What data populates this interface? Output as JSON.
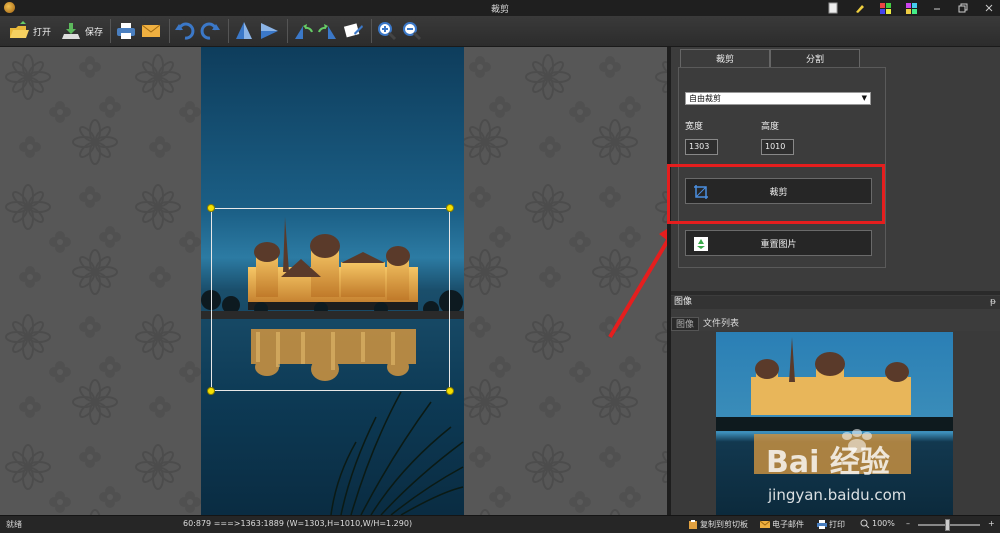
{
  "window": {
    "title": "裁剪"
  },
  "toolbar": {
    "open_label": "打开",
    "save_label": "保存"
  },
  "panel": {
    "tabs": [
      "裁剪",
      "分割"
    ],
    "crop_mode": "自由裁剪",
    "width_label": "宽度",
    "height_label": "高度",
    "width_value": "1303",
    "height_value": "1010",
    "crop_button": "裁剪",
    "reset_button": "重置图片"
  },
  "image_section": {
    "header": "图像",
    "pin": "ᵽ",
    "tabs": [
      "图像",
      "文件列表"
    ],
    "watermark_logo": "Bai 经验",
    "watermark_url": "jingyan.baidu.com"
  },
  "status": {
    "ready": "就绪",
    "coords": "60:879 ===>1363:1889 (W=1303,H=1010,W/H=1.290)",
    "copy_clipboard": "复制到剪切板",
    "email": "电子邮件",
    "print": "打印",
    "zoom": "100%",
    "zoom_minus": "–",
    "zoom_plus": "+"
  },
  "colors": {
    "highlight_box": "#e51e1e",
    "crop_handle": "#f5e000",
    "canvas_bg": "#575757"
  }
}
